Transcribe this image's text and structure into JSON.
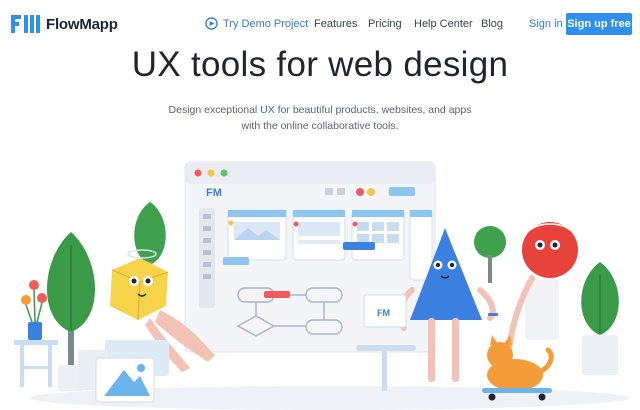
{
  "brand": {
    "name": "FlowMapp",
    "mark": "FM"
  },
  "nav": {
    "demo_label": "Try Demo Project",
    "links": [
      "Features",
      "Pricing",
      "Help Center",
      "Blog"
    ],
    "signin_label": "Sign in",
    "signup_label": "Sign up free"
  },
  "hero": {
    "title": "UX tools for web design",
    "subtitle_line1": "Design exceptional UX for beautiful products, websites, and apps",
    "subtitle_line2": "with the online collaborative tools."
  },
  "illustration": {
    "screen_mark": "FM",
    "laptop_mark": "FM"
  },
  "colors": {
    "accent": "#2e8ff0",
    "link": "#2e7dd8",
    "text": "#1f2430"
  }
}
